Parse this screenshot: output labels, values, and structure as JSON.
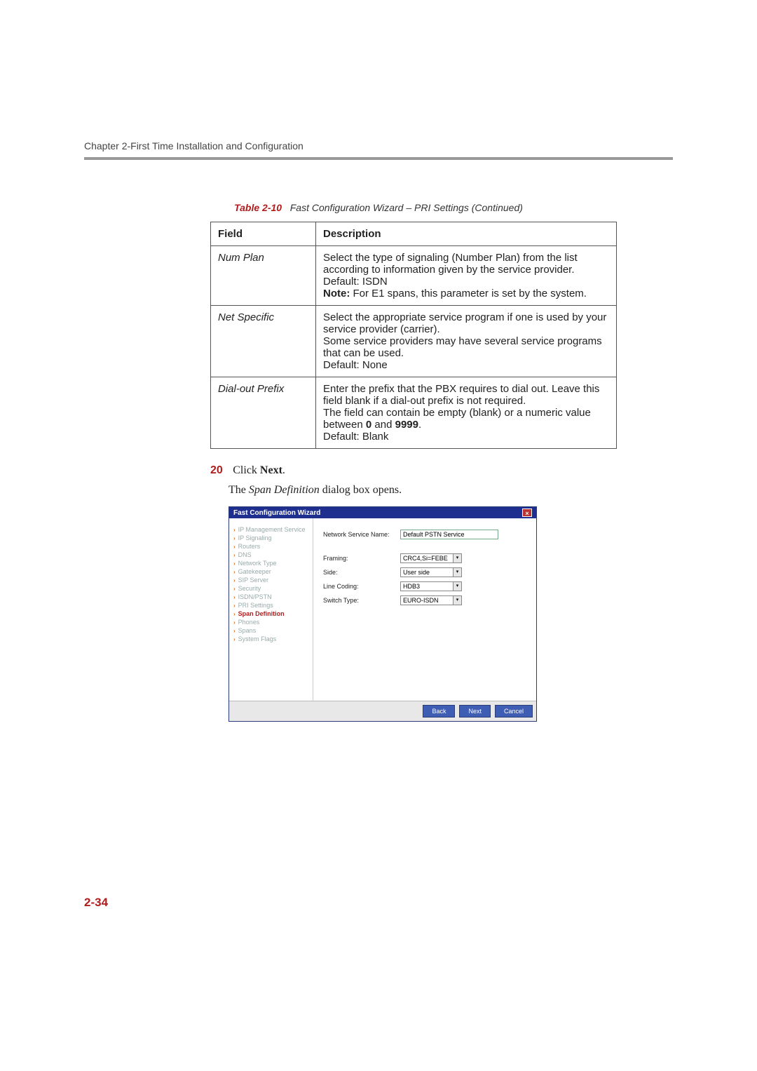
{
  "header": {
    "chapter": "Chapter 2-First Time Installation and Configuration"
  },
  "caption": {
    "label": "Table 2-10",
    "text": "Fast Configuration Wizard – PRI Settings (Continued)"
  },
  "table": {
    "head": {
      "field": "Field",
      "desc": "Description"
    },
    "rows": [
      {
        "field": "Num Plan",
        "desc_1": "Select the type of signaling (Number Plan) from the list according to information given by the service provider.",
        "desc_2": "Default: ISDN",
        "desc_3a": "Note:",
        "desc_3b": " For E1 spans, this parameter is set by the system."
      },
      {
        "field": "Net Specific",
        "desc_1": "Select the appropriate service program if one is used by your service provider (carrier).",
        "desc_2": "Some service providers may have several service programs that can be used.",
        "desc_3": "Default: None"
      },
      {
        "field": "Dial-out Prefix",
        "desc_1": "Enter the prefix that the PBX requires to dial out. Leave this field blank if a dial-out prefix is not required.",
        "desc_2a": "The field can contain be empty (blank) or a numeric value between ",
        "desc_2b": "0",
        "desc_2c": " and ",
        "desc_2d": "9999",
        "desc_2e": ".",
        "desc_3": "Default: Blank"
      }
    ]
  },
  "step": {
    "num": "20",
    "pre": "Click ",
    "bold": "Next",
    "post": "."
  },
  "para": {
    "pre": "The ",
    "ital": "Span Definition",
    "post": " dialog box opens."
  },
  "wizard": {
    "title": "Fast Configuration Wizard",
    "nav": [
      {
        "label": "IP Management Service",
        "state": "done"
      },
      {
        "label": "IP Signaling",
        "state": "done"
      },
      {
        "label": "Routers",
        "state": "done"
      },
      {
        "label": "DNS",
        "state": "done"
      },
      {
        "label": "Network Type",
        "state": "done"
      },
      {
        "label": "Gatekeeper",
        "state": "done"
      },
      {
        "label": "SIP Server",
        "state": "done"
      },
      {
        "label": "Security",
        "state": "done"
      },
      {
        "label": "ISDN/PSTN",
        "state": "done"
      },
      {
        "label": "PRI Settings",
        "state": "done"
      },
      {
        "label": "Span Definition",
        "state": "active"
      },
      {
        "label": "Phones",
        "state": "todo"
      },
      {
        "label": "Spans",
        "state": "todo"
      },
      {
        "label": "System Flags",
        "state": "todo"
      }
    ],
    "fields": {
      "nsn_label": "Network Service Name:",
      "nsn_value": "Default PSTN Service",
      "framing_label": "Framing:",
      "framing_value": "CRC4,Si=FEBE",
      "side_label": "Side:",
      "side_value": "User side",
      "line_label": "Line Coding:",
      "line_value": "HDB3",
      "switch_label": "Switch Type:",
      "switch_value": "EURO-ISDN"
    },
    "buttons": {
      "back": "Back",
      "next": "Next",
      "cancel": "Cancel"
    }
  },
  "page_number": "2-34"
}
